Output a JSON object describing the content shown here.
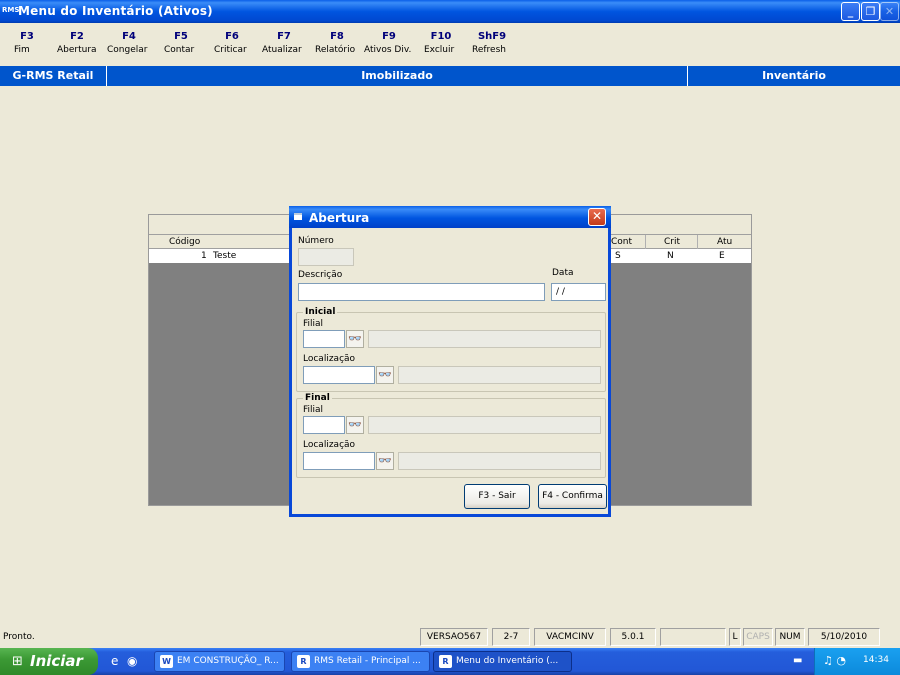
{
  "window": {
    "app_icon_text": "RMS",
    "title": "Menu do Inventário (Ativos)",
    "minimize_glyph": "_",
    "maximize_glyph": "❐",
    "close_glyph": "✕"
  },
  "toolbar": [
    {
      "key": "F3",
      "label": "Fim"
    },
    {
      "key": "F2",
      "label": "Abertura"
    },
    {
      "key": "F4",
      "label": "Congelar"
    },
    {
      "key": "F5",
      "label": "Contar"
    },
    {
      "key": "F6",
      "label": "Criticar"
    },
    {
      "key": "F7",
      "label": "Atualizar"
    },
    {
      "key": "F8",
      "label": "Relatório"
    },
    {
      "key": "F9",
      "label": "Ativos Div."
    },
    {
      "key": "F10",
      "label": "Excluir"
    },
    {
      "key": "ShF9",
      "label": "Refresh"
    }
  ],
  "header": {
    "left": "G-RMS Retail",
    "center": "Imobilizado",
    "right": "Inventário",
    "color": "#0055CC"
  },
  "grid": {
    "columns": [
      "Código",
      "Cont",
      "Crit",
      "Atu"
    ],
    "rows": [
      {
        "codigo": "1",
        "descricao": "Teste",
        "cont": "S",
        "crit": "N",
        "atu": "E"
      }
    ]
  },
  "dialog": {
    "title": "Abertura",
    "close_glyph": "✕",
    "numero_label": "Número",
    "numero_value": "",
    "descricao_label": "Descrição",
    "descricao_value": "",
    "data_label": "Data",
    "data_value": "/ /",
    "inicial": {
      "title": "Inicial",
      "filial_label": "Filial",
      "filial_value": "",
      "filial_desc": "",
      "localizacao_label": "Localização",
      "localizacao_value": "",
      "localizacao_desc": ""
    },
    "final": {
      "title": "Final",
      "filial_label": "Filial",
      "filial_value": "",
      "filial_desc": "",
      "localizacao_label": "Localização",
      "localizacao_value": "",
      "localizacao_desc": ""
    },
    "binoculars_glyph": "👓",
    "buttons": {
      "sair": "F3 - Sair",
      "confirma": "F4 - Confirma"
    }
  },
  "statusbar": {
    "message": "Pronto.",
    "version": "VERSAO567",
    "pos": "2-7",
    "module": "VACMCINV",
    "release": "5.0.1",
    "blank": "",
    "l": "L",
    "caps": "CAPS",
    "num": "NUM",
    "date": "5/10/2010"
  },
  "taskbar": {
    "start_label": "Iniciar",
    "start_glyph": "⊞",
    "quicklaunch": [
      "e",
      "◉"
    ],
    "tasks": [
      {
        "label": "EM CONSTRUÇÃO_ R...",
        "icon": "W"
      },
      {
        "label": "RMS Retail - Principal ...",
        "icon": "R"
      },
      {
        "label": "Menu do Inventário (...",
        "icon": "R"
      }
    ],
    "keyboard_glyph": "▬",
    "tray_glyphs": "♫ ◔",
    "clock": "14:34"
  }
}
